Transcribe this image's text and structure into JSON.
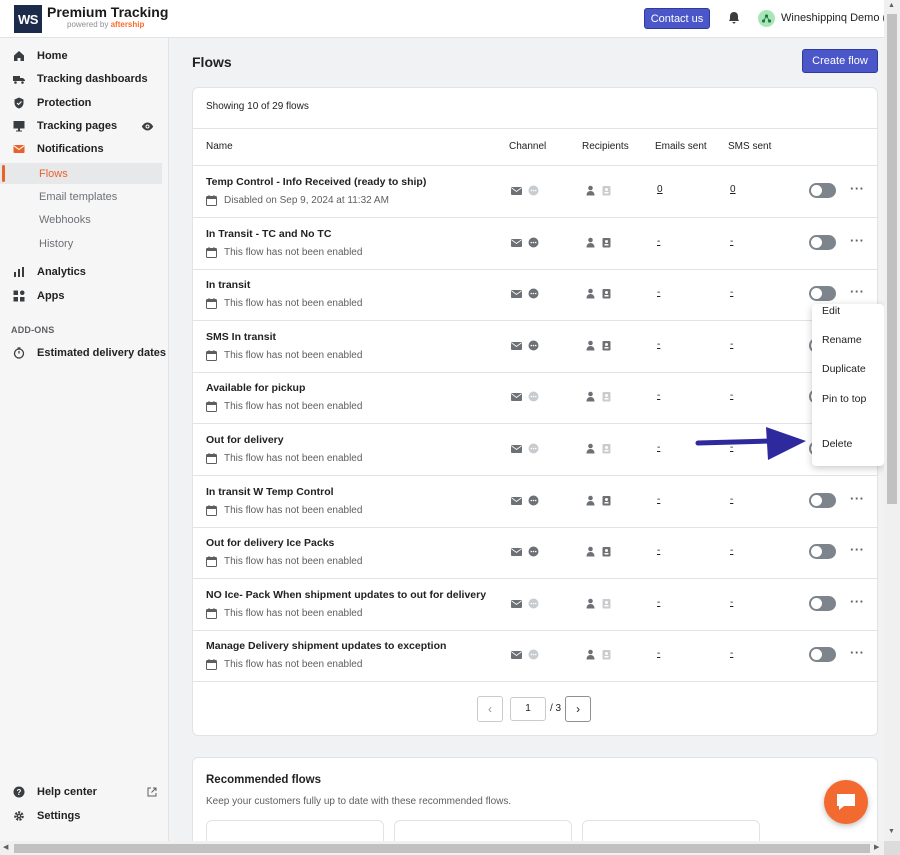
{
  "header": {
    "logo_text": "WS",
    "brand_title": "Premium Tracking",
    "brand_sub_prefix": "powered by",
    "brand_sub_company": "aftership",
    "contact_label": "Contact us",
    "account_name": "Wineshippinq Demo (...",
    "accent_color": "#4b57c9"
  },
  "sidebar": {
    "items": [
      {
        "label": "Home",
        "icon": "home-icon"
      },
      {
        "label": "Tracking dashboards",
        "icon": "truck-icon"
      },
      {
        "label": "Protection",
        "icon": "shield-icon"
      },
      {
        "label": "Tracking pages",
        "icon": "monitor-icon"
      },
      {
        "label": "Notifications",
        "icon": "mail-icon"
      },
      {
        "label": "Analytics",
        "icon": "bar-chart-icon"
      },
      {
        "label": "Apps",
        "icon": "apps-icon"
      },
      {
        "label": "Estimated delivery dates",
        "icon": "timer-icon"
      },
      {
        "label": "Help center",
        "icon": "help-icon"
      },
      {
        "label": "Settings",
        "icon": "gear-icon"
      }
    ],
    "sub_items": [
      "Flows",
      "Email templates",
      "Webhooks",
      "History"
    ],
    "active_sub": "Flows",
    "addons_label": "ADD-ONS"
  },
  "main": {
    "title": "Flows",
    "create_label": "Create flow",
    "showing": "Showing 10 of 29 flows",
    "columns": [
      "Name",
      "Channel",
      "Recipients",
      "Emails sent",
      "SMS sent"
    ],
    "rows": [
      {
        "name": "Temp Control - Info Received (ready to ship)",
        "status": "Disabled on Sep 9, 2024 at 11:32 AM",
        "emails": "0",
        "sms": "0",
        "sms_active": false
      },
      {
        "name": "In Transit - TC and No TC",
        "status": "This flow has not been enabled",
        "emails": "-",
        "sms": "-",
        "sms_active": true
      },
      {
        "name": "In transit",
        "status": "This flow has not been enabled",
        "emails": "-",
        "sms": "-",
        "sms_active": true
      },
      {
        "name": "SMS In transit",
        "status": "This flow has not been enabled",
        "emails": "-",
        "sms": "-",
        "sms_active": true
      },
      {
        "name": "Available for pickup",
        "status": "This flow has not been enabled",
        "emails": "-",
        "sms": "-",
        "sms_active": false
      },
      {
        "name": "Out for delivery",
        "status": "This flow has not been enabled",
        "emails": "-",
        "sms": "-",
        "sms_active": false
      },
      {
        "name": "In transit W Temp Control",
        "status": "This flow has not been enabled",
        "emails": "-",
        "sms": "-",
        "sms_active": true
      },
      {
        "name": "Out for delivery Ice Packs",
        "status": "This flow has not been enabled",
        "emails": "-",
        "sms": "-",
        "sms_active": true
      },
      {
        "name": "NO Ice- Pack When shipment updates to out for delivery",
        "status": "This flow has not been enabled",
        "emails": "-",
        "sms": "-",
        "sms_active": false
      },
      {
        "name": "Manage Delivery shipment updates to exception",
        "status": "This flow has not been enabled",
        "emails": "-",
        "sms": "-",
        "sms_active": false
      }
    ],
    "pager": {
      "current": "1",
      "total": "/ 3"
    },
    "recommended": {
      "title": "Recommended flows",
      "subtitle": "Keep your customers fully up to date with these recommended flows."
    }
  },
  "menu": {
    "items": [
      "Edit",
      "Rename",
      "Duplicate",
      "Pin to top",
      "Delete"
    ]
  }
}
